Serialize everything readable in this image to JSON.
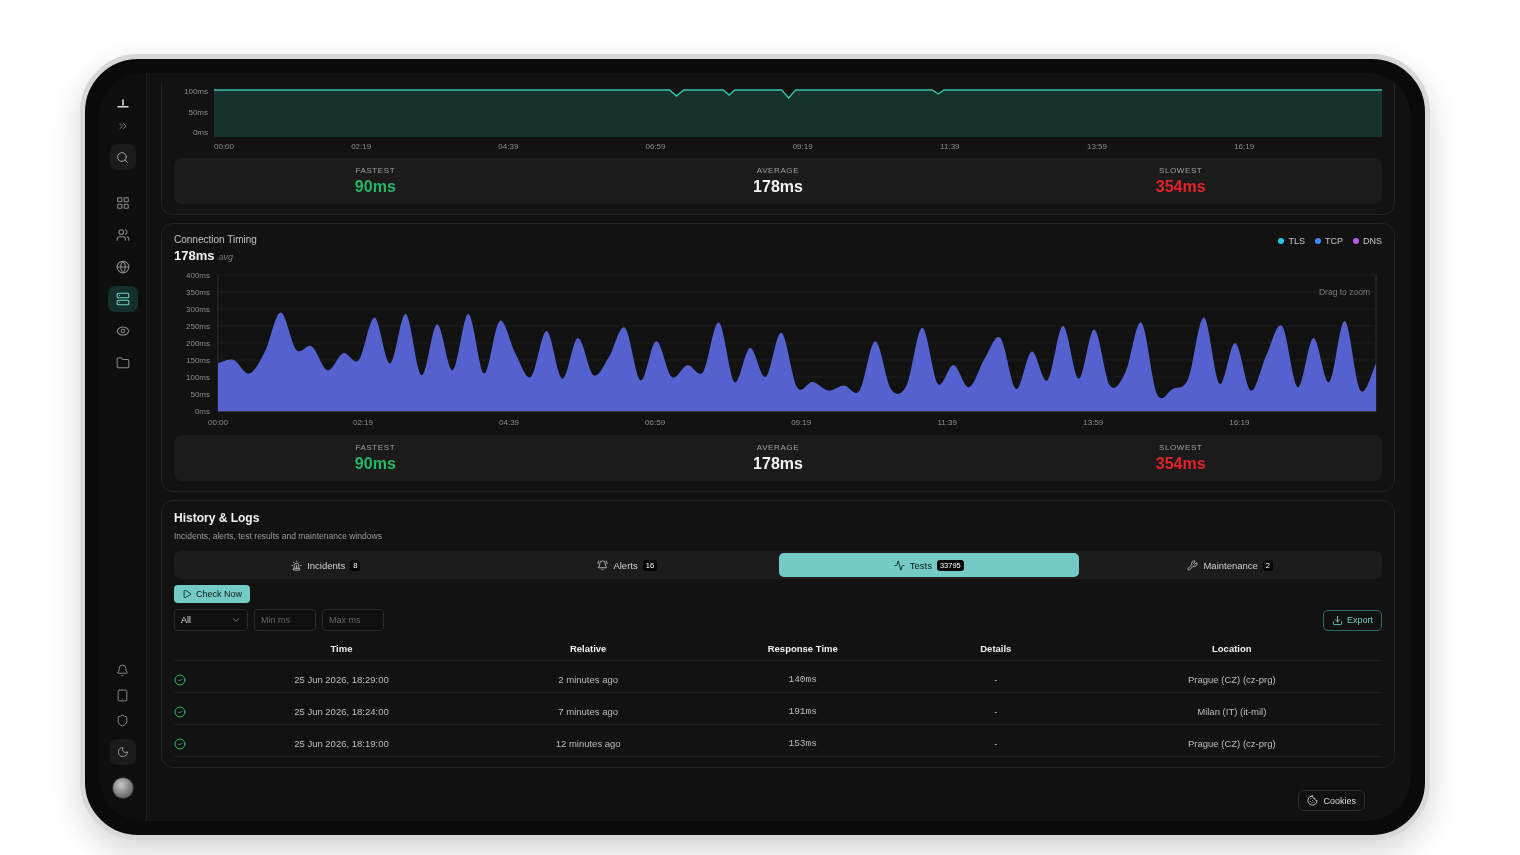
{
  "sidebar": {
    "nav": [
      {
        "selected": false
      },
      {
        "selected": false
      },
      {
        "selected": false
      },
      {
        "selected": true
      },
      {
        "selected": false
      },
      {
        "selected": false
      }
    ]
  },
  "response_chart": {
    "y_ticks": [
      "100ms",
      "50ms",
      "0ms"
    ],
    "x_ticks": [
      "00:00",
      "02:19",
      "04:39",
      "06:59",
      "09:19",
      "11:39",
      "13:59",
      "16:19"
    ]
  },
  "response_stats": [
    {
      "kind": "fastest",
      "label": "FASTEST",
      "value": "90ms"
    },
    {
      "kind": "average",
      "label": "AVERAGE",
      "value": "178ms"
    },
    {
      "kind": "slowest",
      "label": "SLOWEST",
      "value": "354ms"
    }
  ],
  "connection_timing": {
    "average": "178ms",
    "avg_label": "avg",
    "legend": [
      {
        "label": "TLS",
        "color": "#1fc8e8"
      },
      {
        "label": "TCP",
        "color": "#3b8cf5"
      },
      {
        "label": "DNS",
        "color": "#b65cf2"
      }
    ],
    "hint": "Drag to zoom",
    "chart_data": {
      "type": "area",
      "title": "Connection Timing",
      "x": [
        0,
        15,
        30,
        45,
        60,
        75,
        90,
        105,
        120,
        135,
        150,
        165,
        180,
        195,
        210,
        225,
        240,
        255,
        270,
        285,
        300,
        315,
        330,
        345,
        360,
        375,
        390,
        405,
        420,
        435,
        450,
        465,
        480,
        495,
        510,
        525,
        540,
        555,
        570,
        585,
        600,
        615,
        630,
        645,
        660,
        675,
        690,
        705,
        720,
        735,
        750,
        765,
        780,
        795,
        810,
        825,
        840,
        855,
        870,
        885,
        900,
        915,
        930,
        945,
        960,
        975,
        990,
        1005,
        1020,
        1035,
        1050,
        1065,
        1080,
        1095,
        1110
      ],
      "values": [
        140,
        150,
        110,
        175,
        290,
        180,
        190,
        120,
        170,
        150,
        275,
        140,
        285,
        105,
        255,
        120,
        285,
        110,
        265,
        170,
        100,
        235,
        95,
        215,
        105,
        160,
        245,
        90,
        205,
        100,
        135,
        115,
        260,
        85,
        185,
        100,
        230,
        70,
        85,
        60,
        75,
        60,
        205,
        65,
        75,
        245,
        80,
        135,
        70,
        155,
        215,
        65,
        175,
        90,
        250,
        95,
        240,
        75,
        115,
        260,
        50,
        65,
        95,
        275,
        80,
        200,
        60,
        165,
        250,
        70,
        215,
        85,
        265,
        60,
        140
      ],
      "xlim": [
        0,
        1110
      ],
      "ylim": [
        0,
        400
      ],
      "xticks": [
        {
          "value": 0,
          "label": "00:00"
        },
        {
          "value": 139,
          "label": "02:19"
        },
        {
          "value": 279,
          "label": "04:39"
        },
        {
          "value": 419,
          "label": "06:59"
        },
        {
          "value": 559,
          "label": "09:19"
        },
        {
          "value": 699,
          "label": "11:39"
        },
        {
          "value": 839,
          "label": "13:59"
        },
        {
          "value": 979,
          "label": "16:19"
        }
      ],
      "yticks": [
        {
          "value": 0,
          "label": "0ms"
        },
        {
          "value": 50,
          "label": "50ms"
        },
        {
          "value": 100,
          "label": "100ms"
        },
        {
          "value": 150,
          "label": "150ms"
        },
        {
          "value": 200,
          "label": "200ms"
        },
        {
          "value": 250,
          "label": "250ms"
        },
        {
          "value": 300,
          "label": "300ms"
        },
        {
          "value": 350,
          "label": "350ms"
        },
        {
          "value": 400,
          "label": "400ms"
        }
      ]
    },
    "stats": [
      {
        "kind": "fastest",
        "label": "FASTEST",
        "value": "90ms"
      },
      {
        "kind": "average",
        "label": "AVERAGE",
        "value": "178ms"
      },
      {
        "kind": "slowest",
        "label": "SLOWEST",
        "value": "354ms"
      }
    ]
  },
  "history": {
    "title": "History & Logs",
    "subtitle": "Incidents, alerts, test results and maintenance windows",
    "tabs": [
      {
        "label": "Incidents",
        "count": "8",
        "selected": false
      },
      {
        "label": "Alerts",
        "count": "16",
        "selected": false
      },
      {
        "label": "Tests",
        "count": "33795",
        "selected": true
      },
      {
        "label": "Maintenance",
        "count": "2",
        "selected": false
      }
    ],
    "check_button": "Check Now",
    "status_select": {
      "value": "All"
    },
    "fields": [
      {
        "placeholder": "Min ms"
      },
      {
        "placeholder": "Max ms"
      }
    ],
    "export_button": "Export",
    "table": {
      "columns": [
        "Time",
        "Relative",
        "Response Time",
        "Details",
        "Location"
      ],
      "rows": [
        {
          "passed": true,
          "time": "25 Jun 2026, 18:29:00",
          "relative": "2 minutes ago",
          "response_time": "140ms",
          "details": "-",
          "location": "Prague (CZ) (cz-prg)"
        },
        {
          "passed": true,
          "time": "25 Jun 2026, 18:24:00",
          "relative": "7 minutes ago",
          "response_time": "191ms",
          "details": "-",
          "location": "Milan (IT) (it-mil)"
        },
        {
          "passed": true,
          "time": "25 Jun 2026, 18:19:00",
          "relative": "12 minutes ago",
          "response_time": "153ms",
          "details": "-",
          "location": "Prague (CZ) (cz-prg)"
        }
      ]
    }
  },
  "cookies_button": "Cookies"
}
